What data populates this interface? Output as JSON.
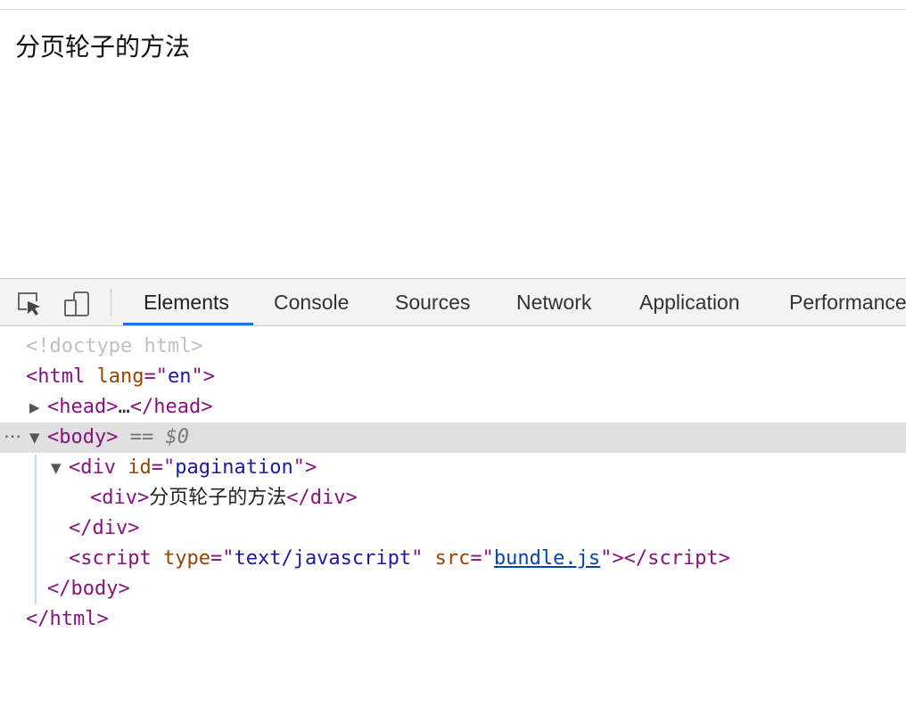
{
  "page": {
    "text": "分页轮子的方法"
  },
  "devtools": {
    "toolbar": {
      "icons": [
        "inspect-element-icon",
        "device-toolbar-icon"
      ],
      "tabs": [
        "Elements",
        "Console",
        "Sources",
        "Network",
        "Application",
        "Performance"
      ],
      "active_tab": "Elements",
      "accent_color": "#1a73e8"
    },
    "tree": {
      "doctype": "<!doctype html>",
      "html_open": {
        "tag": "html",
        "attr": "lang",
        "value": "en"
      },
      "head": {
        "open": "head",
        "ellipsis": "…",
        "close": "/head"
      },
      "body": {
        "tag": "body",
        "eq": "==",
        "var": "$0"
      },
      "div": {
        "tag": "div",
        "attr": "id",
        "value": "pagination"
      },
      "inner_div": {
        "tag": "div",
        "text": "分页轮子的方法",
        "close": "/div"
      },
      "div_close": "/div",
      "script": {
        "tag": "script",
        "attr1": "type",
        "value1": "text/javascript",
        "attr2": "src",
        "value2": "bundle.js",
        "close": "/script"
      },
      "body_close": "/body",
      "html_close": "/html"
    }
  },
  "colors": {
    "tag": "#881280",
    "attribute": "#994500",
    "attribute_value": "#1a1aa6",
    "selected_row": "#e0e0e0"
  }
}
